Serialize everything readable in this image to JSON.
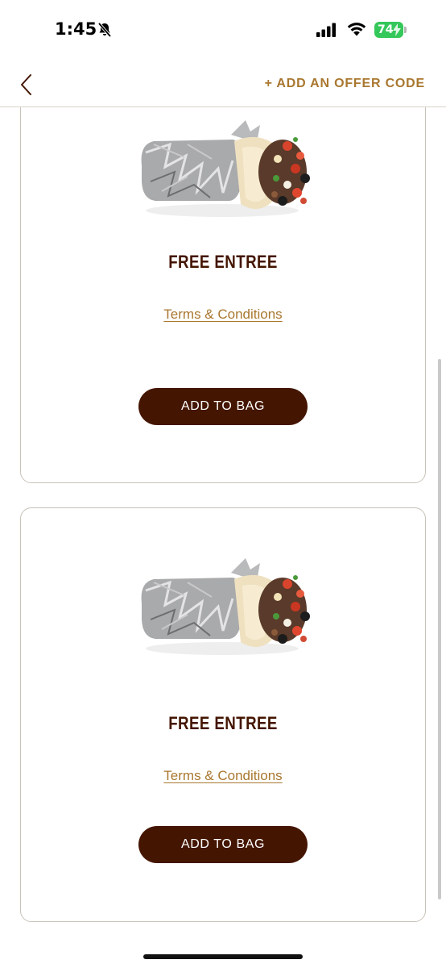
{
  "status_bar": {
    "time": "1:45",
    "battery": "74"
  },
  "nav": {
    "offer_code_label": "+ ADD AN OFFER CODE"
  },
  "offers": [
    {
      "title": "FREE ENTREE",
      "terms_label": "Terms & Conditions",
      "button_label": "ADD TO BAG",
      "image_icon": "burrito-image"
    },
    {
      "title": "FREE ENTREE",
      "terms_label": "Terms & Conditions",
      "button_label": "ADD TO BAG",
      "image_icon": "burrito-image"
    }
  ],
  "colors": {
    "brand_brown": "#441500",
    "accent_gold": "#a9772f",
    "card_border": "#c8c2b8",
    "battery_green": "#34c759"
  }
}
